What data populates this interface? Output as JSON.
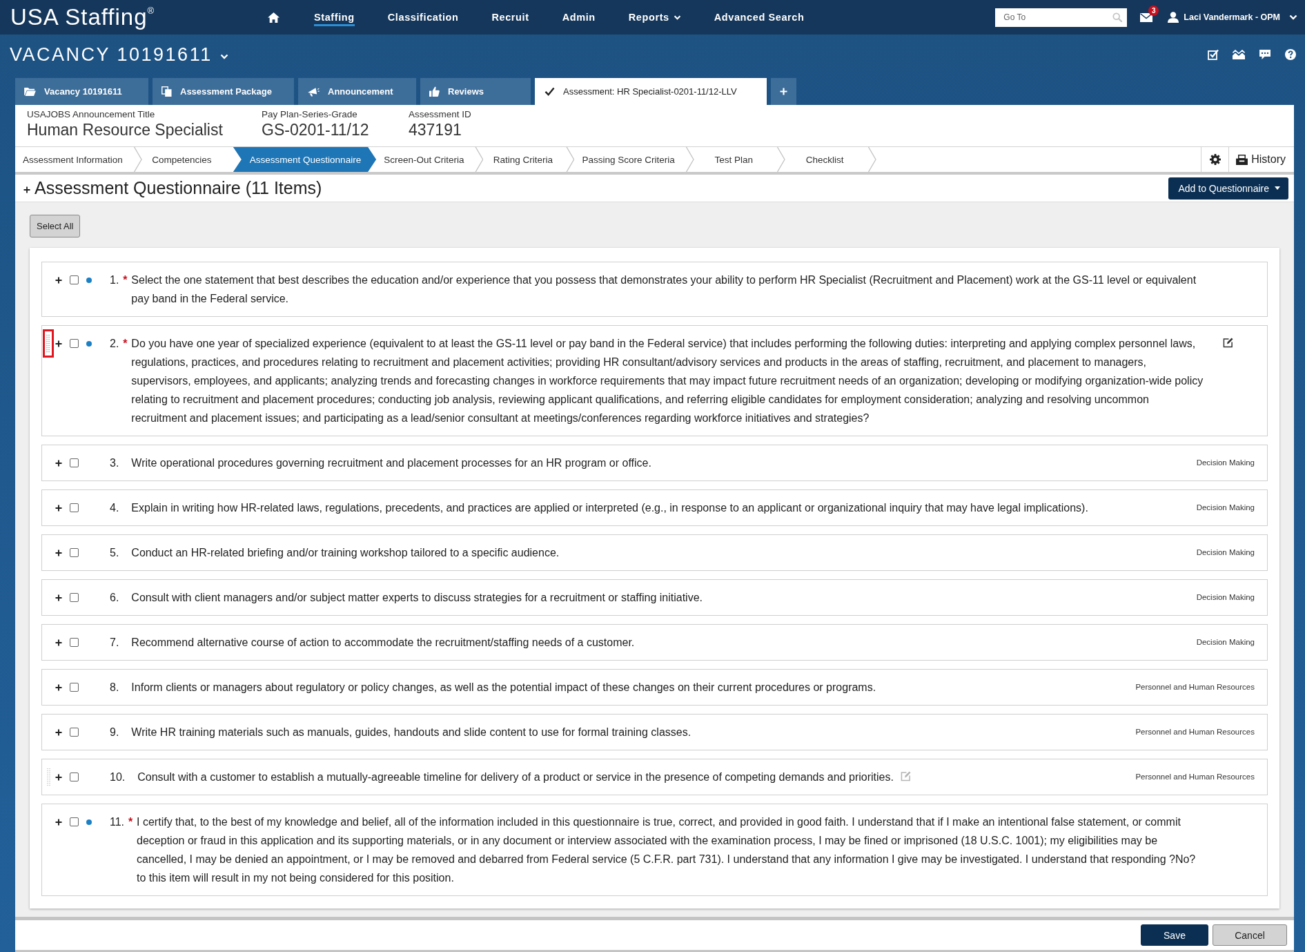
{
  "top_nav": {
    "logo": "USA Staffing$^{®}$",
    "items": [
      {
        "label": "Staffing",
        "selected": true,
        "dropdown": false
      },
      {
        "label": "Classification",
        "selected": false,
        "dropdown": false
      },
      {
        "label": "Recruit",
        "selected": false,
        "dropdown": false
      },
      {
        "label": "Admin",
        "selected": false,
        "dropdown": false
      },
      {
        "label": "Reports",
        "selected": false,
        "dropdown": true
      },
      {
        "label": "Advanced Search",
        "selected": false,
        "dropdown": false
      }
    ],
    "search": {
      "placeholder": "Go To"
    },
    "messages_badge": "3",
    "user": "Laci Vandermark - OPM"
  },
  "vacancy_header": {
    "title": "VACANCY 10191611"
  },
  "record_tabs": [
    {
      "label": "Vacancy 10191611",
      "kind": "vacancy",
      "selected": false
    },
    {
      "label": "Assessment Package",
      "kind": "package",
      "selected": false
    },
    {
      "label": "Announcement",
      "kind": "announcement",
      "selected": false
    },
    {
      "label": "Reviews",
      "kind": "reviews",
      "selected": false
    },
    {
      "label": "Assessment: HR Specialist-0201-11/12-LLV",
      "kind": "assessment",
      "selected": true
    }
  ],
  "summary": [
    {
      "label": "USAJOBS Announcement Title",
      "value": "Human Resource Specialist"
    },
    {
      "label": "Pay Plan-Series-Grade",
      "value": "GS-0201-11/12"
    },
    {
      "label": "Assessment ID",
      "value": "437191"
    }
  ],
  "steps": [
    {
      "label": "Assessment Information",
      "selected": false
    },
    {
      "label": "Competencies",
      "selected": false
    },
    {
      "label": "Assessment Questionnaire",
      "selected": true
    },
    {
      "label": "Screen-Out Criteria",
      "selected": false
    },
    {
      "label": "Rating Criteria",
      "selected": false
    },
    {
      "label": "Passing Score Criteria",
      "selected": false
    },
    {
      "label": "Test Plan",
      "selected": false
    },
    {
      "label": "Checklist",
      "selected": false
    }
  ],
  "history_button": "History",
  "questionnaire": {
    "title": "Assessment Questionnaire (11 Items)",
    "add_button": "Add to Questionnaire",
    "select_all": "Select All",
    "items": [
      {
        "number": "1.",
        "required_marker": "*",
        "text": "Select the one statement that best describes the education and/or experience that you possess that demonstrates your ability to perform HR Specialist (Recruitment and Placement) work at the GS-11 level or equivalent pay band in the Federal service.",
        "checked": false,
        "status_dot": true,
        "drag_handle": false,
        "annotated": false,
        "edit_icon": false
      },
      {
        "number": "2.",
        "required_marker": "*",
        "text": "Do you have one year of specialized experience (equivalent to at least the GS-11 level or pay band in the Federal service) that includes performing the following duties: interpreting and applying complex personnel laws, regulations, practices, and procedures relating to recruitment and placement activities; providing HR consultant/advisory services and products in the areas of staffing, recruitment, and placement to managers, supervisors, employees, and applicants; analyzing trends and forecasting changes in workforce requirements that may impact future recruitment needs of an organization; developing or modifying organization-wide policy relating to recruitment and placement procedures; conducting job analysis, reviewing applicant qualifications, and referring eligible candidates for employment consideration; analyzing and resolving uncommon recruitment and placement issues; and participating as a lead/senior consultant at meetings/conferences regarding workforce initiatives and strategies?",
        "checked": false,
        "status_dot": true,
        "drag_handle": true,
        "annotated": true,
        "edit_icon": true,
        "edit_inline": false
      },
      {
        "number": "3.",
        "text": "Write operational procedures governing recruitment and placement processes for an HR program or office.",
        "competency": "Decision Making",
        "checked": false,
        "status_dot": false,
        "drag_handle": false,
        "annotated": false,
        "edit_icon": false
      },
      {
        "number": "4.",
        "text": "Explain in writing how HR-related laws, regulations, precedents, and practices are applied or interpreted (e.g., in response to an applicant or organizational inquiry that may have legal implications).",
        "competency": "Decision Making",
        "checked": false,
        "status_dot": false,
        "drag_handle": false,
        "annotated": false,
        "edit_icon": false
      },
      {
        "number": "5.",
        "text": "Conduct an HR-related briefing and/or training workshop tailored to a specific audience.",
        "competency": "Decision Making",
        "checked": false,
        "status_dot": false,
        "drag_handle": false,
        "annotated": false,
        "edit_icon": false
      },
      {
        "number": "6.",
        "text": "Consult with client managers and/or subject matter experts to discuss strategies for a recruitment or staffing initiative.",
        "competency": "Decision Making",
        "checked": false,
        "status_dot": false,
        "drag_handle": false,
        "annotated": false,
        "edit_icon": false
      },
      {
        "number": "7.",
        "text": "Recommend alternative course of action to accommodate the recruitment/staffing needs of a customer.",
        "competency": "Decision Making",
        "checked": false,
        "status_dot": false,
        "drag_handle": false,
        "annotated": false,
        "edit_icon": false
      },
      {
        "number": "8.",
        "text": "Inform clients or managers about regulatory or policy changes, as well as the potential impact of these changes on their current procedures or programs.",
        "competency": "Personnel and Human Resources",
        "checked": false,
        "status_dot": false,
        "drag_handle": false,
        "annotated": false,
        "edit_icon": false
      },
      {
        "number": "9.",
        "text": "Write HR training materials such as manuals, guides, handouts and slide content to use for formal training classes.",
        "competency": "Personnel and Human Resources",
        "checked": false,
        "status_dot": false,
        "drag_handle": false,
        "annotated": false,
        "edit_icon": false
      },
      {
        "number": "10.",
        "text": "Consult with a customer to establish a mutually-agreeable timeline for delivery of a product or service in the presence of competing demands and priorities.",
        "competency": "Personnel and Human Resources",
        "checked": false,
        "status_dot": false,
        "drag_handle": true,
        "annotated": false,
        "edit_icon": true,
        "edit_inline": true
      },
      {
        "number": "11.",
        "required_marker": "*",
        "text": "I certify that, to the best of my knowledge and belief, all of the information included in this questionnaire is true, correct, and provided in good faith. I understand that if I make an intentional false statement, or commit deception or fraud in this application and its supporting materials, or in any document or interview associated with the examination process, I may be fined or imprisoned (18 U.S.C. 1001); my eligibilities may be cancelled, I may be denied an appointment, or I may be removed and debarred from Federal service (5 C.F.R. part 731). I understand that any information I give may be investigated. I understand that responding ?No? to this item will result in my not being considered for this position.",
        "checked": false,
        "status_dot": true,
        "drag_handle": false,
        "annotated": false,
        "edit_icon": false
      }
    ]
  },
  "footer": {
    "buttons": [
      {
        "label": "Save",
        "kind": "primary"
      },
      {
        "label": "Cancel",
        "kind": "secondary"
      }
    ]
  }
}
